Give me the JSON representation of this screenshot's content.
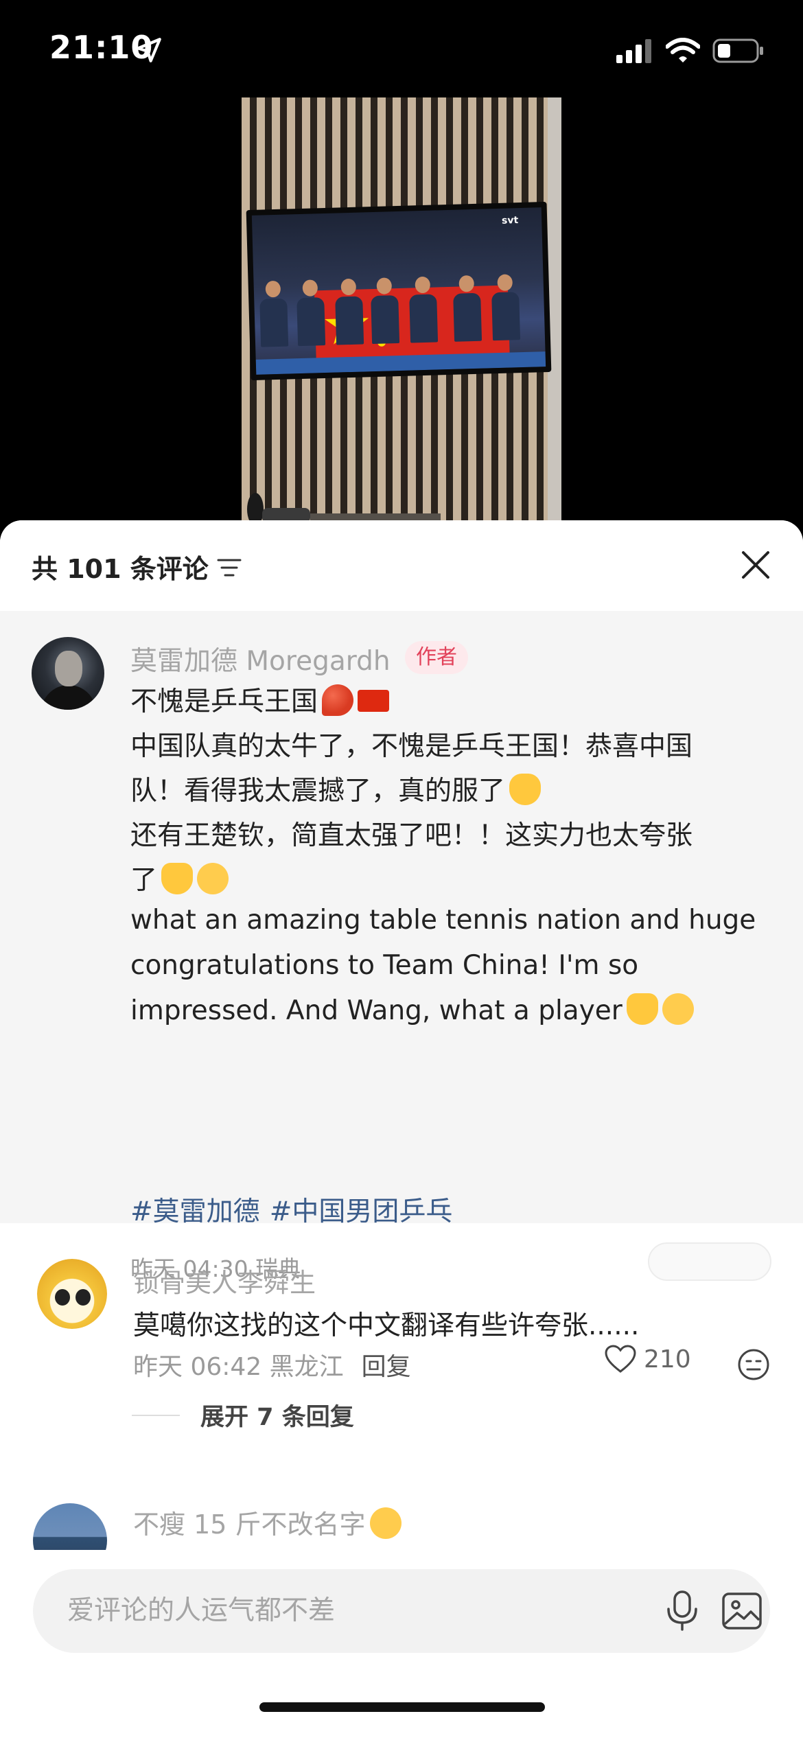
{
  "status_bar": {
    "time": "21:10"
  },
  "comments_sheet": {
    "title": "共 101 条评论",
    "pinned": {
      "author": "莫雷加德 Moregardh",
      "author_tag": "作者",
      "text_lines_cn": [
        "不愧是乒乓王国",
        "中国队真的太牛了，不愧是乒乓王国！恭喜中国",
        "队！看得我太震撼了，真的服了",
        "还有王楚钦，简直太强了吧！！这实力也太夸张",
        "了"
      ],
      "text_lines_en": [
        "what an amazing table tennis nation and huge",
        "congratulations to Team China! I'm so",
        "impressed. And Wang, what a player"
      ],
      "hashtags": [
        "#莫雷加德",
        "#中国男团乒乓"
      ],
      "meta": "昨天 04:30 瑞典"
    },
    "comments": [
      {
        "user": "锁骨美人李舜生",
        "text": "莫噶你这找的这个中文翻译有些许夸张......",
        "meta": "昨天 06:42 黑龙江",
        "reply_label": "回复",
        "likes": "210",
        "expand_label": "展开 7 条回复"
      },
      {
        "user": "不瘦 15 斤不改名字"
      }
    ],
    "input": {
      "placeholder": "爱评论的人运气都不差"
    }
  },
  "colors": {
    "accent_tag": "#e2425a",
    "hashtag": "#3b5c8a",
    "muted": "#a5a5a5"
  },
  "icons": [
    "location-arrow-icon",
    "signal-icon",
    "wifi-icon",
    "battery-icon",
    "filter-icon",
    "close-icon",
    "heart-icon",
    "emoji-icon",
    "mic-icon",
    "image-icon"
  ]
}
